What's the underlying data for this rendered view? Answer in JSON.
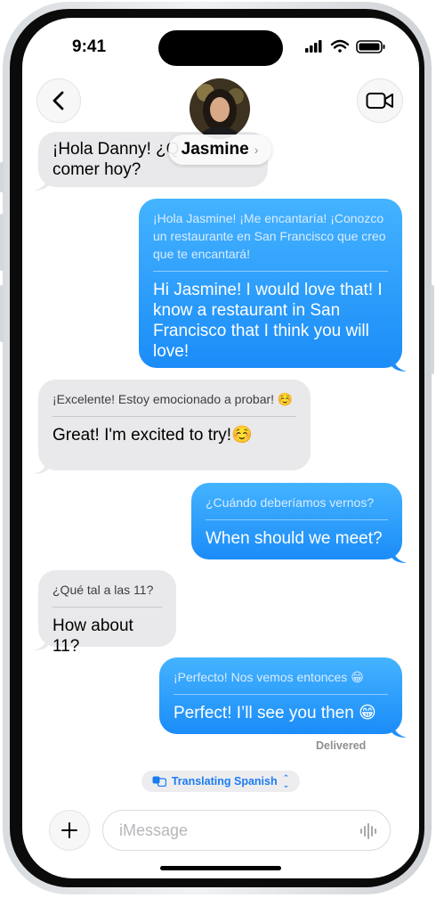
{
  "status_bar": {
    "time": "9:41"
  },
  "header": {
    "contact_name": "Jasmine",
    "back_icon": "chevron-left-icon",
    "video_icon": "video-camera-icon"
  },
  "messages": [
    {
      "direction": "incoming",
      "original": "¡Hola Danny! ¿Q",
      "translation": "comer hoy?"
    },
    {
      "direction": "outgoing",
      "original": "¡Hola Jasmine! ¡Me encantaría! ¡Conozco un restaurante en San Francisco que creo que te encantará!",
      "translation": "Hi Jasmine! I would love that! I know a restaurant in San Francisco that I think you will love!"
    },
    {
      "direction": "incoming",
      "original": "¡Excelente! Estoy emocionado a probar! ☺️",
      "translation": "Great! I'm excited to try!☺️"
    },
    {
      "direction": "outgoing",
      "original": "¿Cuándo deberíamos vernos?",
      "translation": "When should we meet?"
    },
    {
      "direction": "incoming",
      "original": "¿Qué tal a las 11?",
      "translation": "How about 11?"
    },
    {
      "direction": "outgoing",
      "original": "¡Perfecto! Nos vemos entonces 😁",
      "translation": "Perfect! I’ll see you then 😁"
    }
  ],
  "delivered_label": "Delivered",
  "translation_pill": {
    "label": "Translating Spanish"
  },
  "composer": {
    "placeholder": "iMessage",
    "plus_icon": "plus-icon",
    "mic_icon": "waveform-icon"
  },
  "colors": {
    "outgoing_bubble": "#1b8cf8",
    "incoming_bubble": "#e9e9eb",
    "accent": "#1c7cf0"
  }
}
